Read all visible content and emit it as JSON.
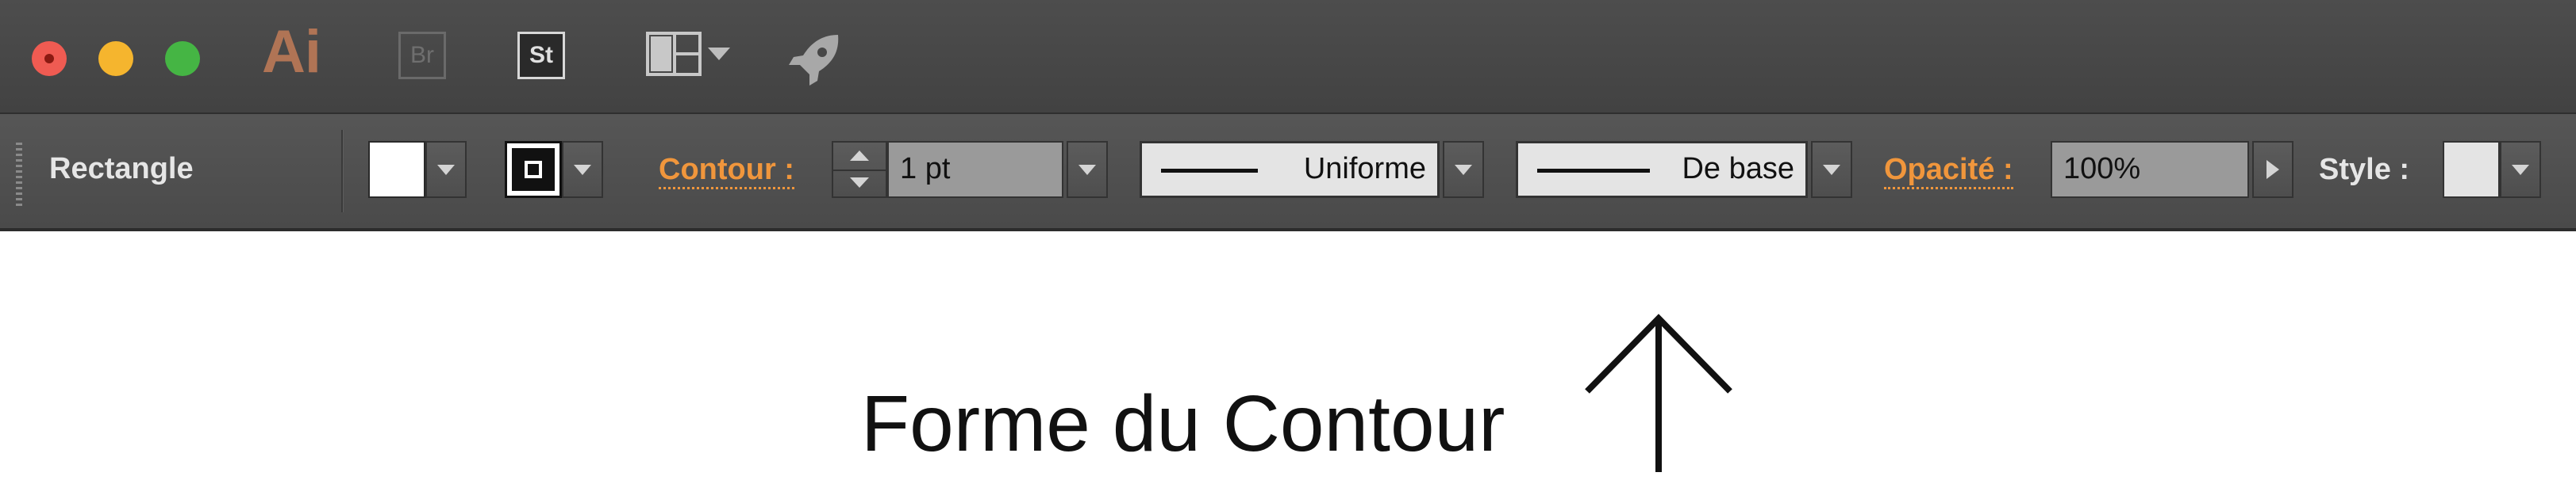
{
  "app": {
    "logo_text": "Ai",
    "bridge_label": "Br",
    "stock_label": "St"
  },
  "control_bar": {
    "shape_label": "Rectangle",
    "stroke_label": "Contour :",
    "stroke_weight_value": "1 pt",
    "stroke_profile_value": "Uniforme",
    "brush_value": "De base",
    "opacity_label": "Opacité :",
    "opacity_value": "100%",
    "style_label": "Style :"
  },
  "annotation": {
    "text": "Forme du Contour"
  },
  "colors": {
    "titlebar_bg": "#474747",
    "controlbar_bg": "#505050",
    "accent_orange": "#f0963c",
    "ai_logo": "#b07455",
    "fill_swatch": "#ffffff",
    "style_swatch": "#e4e4e4"
  },
  "icons": {
    "window_controls": [
      "close-icon",
      "minimize-icon",
      "zoom-icon"
    ],
    "workspace": "layout-grid-icon",
    "gpu": "rocket-icon"
  }
}
